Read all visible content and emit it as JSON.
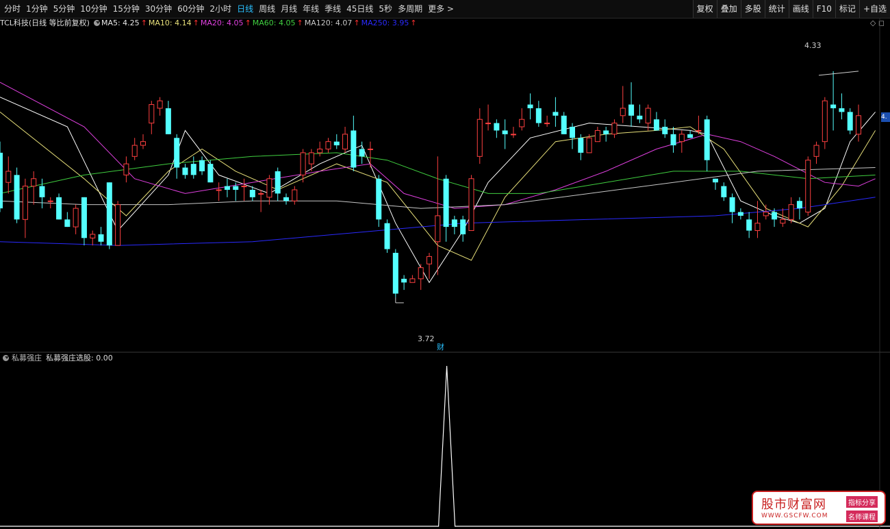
{
  "toolbar": {
    "periods": [
      "分时",
      "1分钟",
      "5分钟",
      "10分钟",
      "15分钟",
      "30分钟",
      "60分钟",
      "2小时",
      "日线",
      "周线",
      "月线",
      "年线",
      "季线",
      "45日线",
      "5秒",
      "多周期",
      "更多 >"
    ],
    "active_index": 8,
    "buttons": [
      "复权",
      "叠加",
      "多股",
      "统计",
      "画线",
      "F10",
      "标记",
      "+自选"
    ]
  },
  "legend": {
    "title": "TCL科技(日线 等比前复权)",
    "items": [
      {
        "label": "MA5: 4.25",
        "color": "#ffffff"
      },
      {
        "label": "MA10: 4.14",
        "color": "#e8e07a"
      },
      {
        "label": "MA20: 4.05",
        "color": "#e040e0"
      },
      {
        "label": "MA60: 4.05",
        "color": "#40d040"
      },
      {
        "label": "MA120: 4.07",
        "color": "#c8c8c8"
      },
      {
        "label": "MA250: 3.95",
        "color": "#2a2aff"
      }
    ],
    "arrow": "↑"
  },
  "right_icons": "◇ ◻",
  "price_tag": "4.",
  "annotations": {
    "high": "4.33",
    "low": "3.72",
    "fin_badge": "财"
  },
  "indicator": {
    "name": "私募强庄",
    "value_label": "私募强庄选股: 0.00"
  },
  "watermark": {
    "title": "股市财富网",
    "url": "WWW.GSCFW.COM",
    "tag1": "指标分享",
    "tag2": "名师课程"
  },
  "colors": {
    "up": "#ff4040",
    "down": "#54ffff",
    "background": "#000000",
    "active_tab": "#29c0ff"
  },
  "chart_data": {
    "type": "candlestick",
    "ylim": [
      3.62,
      4.4
    ],
    "high_label": 4.33,
    "low_label": 3.72,
    "candles": [
      {
        "o": 4.11,
        "c": 3.96,
        "h": 4.14,
        "l": 3.95
      },
      {
        "o": 4.03,
        "c": 4.06,
        "h": 4.1,
        "l": 4.0
      },
      {
        "o": 4.05,
        "c": 3.93,
        "h": 4.07,
        "l": 3.92
      },
      {
        "o": 3.93,
        "c": 4.02,
        "h": 4.04,
        "l": 3.88
      },
      {
        "o": 4.02,
        "c": 4.04,
        "h": 4.06,
        "l": 3.97
      },
      {
        "o": 4.02,
        "c": 3.99,
        "h": 4.04,
        "l": 3.96
      },
      {
        "o": 3.98,
        "c": 3.98,
        "h": 3.99,
        "l": 3.96
      },
      {
        "o": 3.99,
        "c": 3.93,
        "h": 4.0,
        "l": 3.93
      },
      {
        "o": 3.93,
        "c": 3.91,
        "h": 3.95,
        "l": 3.91
      },
      {
        "o": 3.91,
        "c": 3.96,
        "h": 3.97,
        "l": 3.89
      },
      {
        "o": 3.99,
        "c": 3.88,
        "h": 3.99,
        "l": 3.86
      },
      {
        "o": 3.88,
        "c": 3.89,
        "h": 3.9,
        "l": 3.86
      },
      {
        "o": 3.89,
        "c": 3.87,
        "h": 3.91,
        "l": 3.86
      },
      {
        "o": 4.03,
        "c": 3.86,
        "h": 4.03,
        "l": 3.85
      },
      {
        "o": 3.86,
        "c": 3.97,
        "h": 3.98,
        "l": 3.86
      },
      {
        "o": 4.05,
        "c": 4.08,
        "h": 4.1,
        "l": 4.03
      },
      {
        "o": 4.1,
        "c": 4.13,
        "h": 4.15,
        "l": 4.09
      },
      {
        "o": 4.13,
        "c": 4.14,
        "h": 4.16,
        "l": 4.12
      },
      {
        "o": 4.19,
        "c": 4.24,
        "h": 4.25,
        "l": 4.16
      },
      {
        "o": 4.23,
        "c": 4.25,
        "h": 4.26,
        "l": 4.21
      },
      {
        "o": 4.23,
        "c": 4.16,
        "h": 4.25,
        "l": 4.16
      },
      {
        "o": 4.15,
        "c": 4.07,
        "h": 4.16,
        "l": 4.04
      },
      {
        "o": 4.07,
        "c": 4.05,
        "h": 4.08,
        "l": 4.04
      },
      {
        "o": 4.08,
        "c": 4.05,
        "h": 4.1,
        "l": 4.04
      },
      {
        "o": 4.09,
        "c": 4.06,
        "h": 4.1,
        "l": 4.05
      },
      {
        "o": 4.08,
        "c": 4.03,
        "h": 4.09,
        "l": 4.03
      },
      {
        "o": 4.01,
        "c": 4.01,
        "h": 4.03,
        "l": 3.98
      },
      {
        "o": 4.02,
        "c": 4.01,
        "h": 4.04,
        "l": 3.99
      },
      {
        "o": 4.02,
        "c": 4.01,
        "h": 4.03,
        "l": 3.98
      },
      {
        "o": 4.02,
        "c": 4.02,
        "h": 4.04,
        "l": 3.98
      },
      {
        "o": 4.01,
        "c": 3.99,
        "h": 4.02,
        "l": 3.98
      },
      {
        "o": 4.0,
        "c": 4.0,
        "h": 4.01,
        "l": 3.95
      },
      {
        "o": 3.99,
        "c": 4.04,
        "h": 4.05,
        "l": 3.97
      },
      {
        "o": 4.06,
        "c": 4.0,
        "h": 4.07,
        "l": 3.98
      },
      {
        "o": 3.99,
        "c": 3.98,
        "h": 4.0,
        "l": 3.97
      },
      {
        "o": 3.98,
        "c": 4.01,
        "h": 4.02,
        "l": 3.97
      },
      {
        "o": 4.05,
        "c": 4.11,
        "h": 4.12,
        "l": 4.03
      },
      {
        "o": 4.08,
        "c": 4.11,
        "h": 4.12,
        "l": 4.06
      },
      {
        "o": 4.11,
        "c": 4.12,
        "h": 4.14,
        "l": 4.1
      },
      {
        "o": 4.12,
        "c": 4.14,
        "h": 4.15,
        "l": 4.11
      },
      {
        "o": 4.14,
        "c": 4.13,
        "h": 4.16,
        "l": 4.12
      },
      {
        "o": 4.12,
        "c": 4.16,
        "h": 4.18,
        "l": 4.11
      },
      {
        "o": 4.17,
        "c": 4.07,
        "h": 4.21,
        "l": 4.06
      },
      {
        "o": 4.12,
        "c": 4.1,
        "h": 4.14,
        "l": 4.08
      },
      {
        "o": 4.12,
        "c": 4.12,
        "h": 4.14,
        "l": 4.07
      },
      {
        "o": 4.04,
        "c": 3.93,
        "h": 4.05,
        "l": 3.91
      },
      {
        "o": 3.92,
        "c": 3.85,
        "h": 3.93,
        "l": 3.84
      },
      {
        "o": 3.84,
        "c": 3.73,
        "h": 3.85,
        "l": 3.72
      },
      {
        "o": 3.77,
        "c": 3.76,
        "h": 3.78,
        "l": 3.74
      },
      {
        "o": 3.76,
        "c": 3.77,
        "h": 3.78,
        "l": 3.76
      },
      {
        "o": 3.77,
        "c": 3.8,
        "h": 3.81,
        "l": 3.74
      },
      {
        "o": 3.81,
        "c": 3.83,
        "h": 3.84,
        "l": 3.77
      },
      {
        "o": 3.87,
        "c": 3.94,
        "h": 4.1,
        "l": 3.78
      },
      {
        "o": 4.04,
        "c": 3.91,
        "h": 4.05,
        "l": 3.87
      },
      {
        "o": 3.93,
        "c": 3.91,
        "h": 3.94,
        "l": 3.89
      },
      {
        "o": 3.93,
        "c": 3.89,
        "h": 3.94,
        "l": 3.87
      },
      {
        "o": 3.9,
        "c": 4.04,
        "h": 4.05,
        "l": 3.9
      },
      {
        "o": 4.1,
        "c": 4.2,
        "h": 4.23,
        "l": 4.08
      },
      {
        "o": 4.19,
        "c": 4.19,
        "h": 4.24,
        "l": 4.17
      },
      {
        "o": 4.19,
        "c": 4.17,
        "h": 4.2,
        "l": 4.15
      },
      {
        "o": 4.17,
        "c": 4.16,
        "h": 4.2,
        "l": 4.12
      },
      {
        "o": 4.16,
        "c": 4.16,
        "h": 4.18,
        "l": 4.15
      },
      {
        "o": 4.18,
        "c": 4.2,
        "h": 4.23,
        "l": 4.17
      },
      {
        "o": 4.24,
        "c": 4.23,
        "h": 4.27,
        "l": 4.2
      },
      {
        "o": 4.23,
        "c": 4.19,
        "h": 4.25,
        "l": 4.18
      },
      {
        "o": 4.19,
        "c": 4.19,
        "h": 4.21,
        "l": 4.18
      },
      {
        "o": 4.22,
        "c": 4.21,
        "h": 4.26,
        "l": 4.18
      },
      {
        "o": 4.21,
        "c": 4.16,
        "h": 4.22,
        "l": 4.16
      },
      {
        "o": 4.18,
        "c": 4.15,
        "h": 4.19,
        "l": 4.12
      },
      {
        "o": 4.15,
        "c": 4.11,
        "h": 4.16,
        "l": 4.09
      },
      {
        "o": 4.11,
        "c": 4.15,
        "h": 4.16,
        "l": 4.11
      },
      {
        "o": 4.14,
        "c": 4.17,
        "h": 4.18,
        "l": 4.14
      },
      {
        "o": 4.17,
        "c": 4.16,
        "h": 4.18,
        "l": 4.14
      },
      {
        "o": 4.16,
        "c": 4.19,
        "h": 4.2,
        "l": 4.15
      },
      {
        "o": 4.21,
        "c": 4.23,
        "h": 4.29,
        "l": 4.19
      },
      {
        "o": 4.24,
        "c": 4.21,
        "h": 4.3,
        "l": 4.18
      },
      {
        "o": 4.21,
        "c": 4.2,
        "h": 4.24,
        "l": 4.19
      },
      {
        "o": 4.19,
        "c": 4.23,
        "h": 4.24,
        "l": 4.17
      },
      {
        "o": 4.2,
        "c": 4.17,
        "h": 4.22,
        "l": 4.17
      },
      {
        "o": 4.18,
        "c": 4.16,
        "h": 4.2,
        "l": 4.15
      },
      {
        "o": 4.16,
        "c": 4.13,
        "h": 4.18,
        "l": 4.11
      },
      {
        "o": 4.14,
        "c": 4.16,
        "h": 4.17,
        "l": 4.11
      },
      {
        "o": 4.16,
        "c": 4.15,
        "h": 4.17,
        "l": 4.15
      },
      {
        "o": 4.17,
        "c": 4.17,
        "h": 4.21,
        "l": 4.16
      },
      {
        "o": 4.2,
        "c": 4.09,
        "h": 4.21,
        "l": 4.06
      },
      {
        "o": 4.04,
        "c": 4.03,
        "h": 4.04,
        "l": 4.01
      },
      {
        "o": 4.02,
        "c": 3.99,
        "h": 4.03,
        "l": 3.98
      },
      {
        "o": 3.99,
        "c": 3.95,
        "h": 4.0,
        "l": 3.92
      },
      {
        "o": 3.95,
        "c": 3.94,
        "h": 3.96,
        "l": 3.93
      },
      {
        "o": 3.93,
        "c": 3.9,
        "h": 3.95,
        "l": 3.88
      },
      {
        "o": 3.9,
        "c": 3.92,
        "h": 3.98,
        "l": 3.88
      },
      {
        "o": 3.94,
        "c": 3.95,
        "h": 3.97,
        "l": 3.93
      },
      {
        "o": 3.95,
        "c": 3.93,
        "h": 3.96,
        "l": 3.91
      },
      {
        "o": 3.92,
        "c": 3.93,
        "h": 3.96,
        "l": 3.91
      },
      {
        "o": 3.93,
        "c": 3.97,
        "h": 3.99,
        "l": 3.92
      },
      {
        "o": 3.98,
        "c": 3.96,
        "h": 3.99,
        "l": 3.93
      },
      {
        "o": 3.95,
        "c": 4.09,
        "h": 4.1,
        "l": 3.94
      },
      {
        "o": 4.1,
        "c": 4.13,
        "h": 4.14,
        "l": 4.08
      },
      {
        "o": 4.14,
        "c": 4.25,
        "h": 4.26,
        "l": 4.12
      },
      {
        "o": 4.24,
        "c": 4.23,
        "h": 4.33,
        "l": 4.17
      },
      {
        "o": 4.23,
        "c": 4.22,
        "h": 4.27,
        "l": 4.2
      },
      {
        "o": 4.22,
        "c": 4.17,
        "h": 4.23,
        "l": 4.16
      },
      {
        "o": 4.16,
        "c": 4.21,
        "h": 4.24,
        "l": 4.14
      }
    ],
    "ma": [
      {
        "name": "MA5",
        "color": "#ffffff",
        "points": [
          [
            0,
            4.26
          ],
          [
            8,
            4.18
          ],
          [
            14,
            3.9
          ],
          [
            20,
            4.05
          ],
          [
            22,
            4.17
          ],
          [
            26,
            4.05
          ],
          [
            32,
            4.0
          ],
          [
            38,
            4.08
          ],
          [
            43,
            4.13
          ],
          [
            47,
            3.92
          ],
          [
            51,
            3.76
          ],
          [
            55,
            3.9
          ],
          [
            58,
            4.03
          ],
          [
            63,
            4.15
          ],
          [
            70,
            4.19
          ],
          [
            76,
            4.18
          ],
          [
            82,
            4.17
          ],
          [
            84,
            4.16
          ],
          [
            88,
            3.98
          ],
          [
            92,
            3.94
          ],
          [
            95,
            3.92
          ],
          [
            98,
            3.96
          ],
          [
            101,
            4.14
          ],
          [
            104,
            4.22
          ]
        ]
      },
      {
        "name": "MA10",
        "color": "#e8e07a",
        "points": [
          [
            0,
            4.22
          ],
          [
            10,
            4.04
          ],
          [
            15,
            3.94
          ],
          [
            20,
            4.06
          ],
          [
            24,
            4.12
          ],
          [
            28,
            4.06
          ],
          [
            33,
            4.01
          ],
          [
            40,
            4.08
          ],
          [
            46,
            4.03
          ],
          [
            52,
            3.86
          ],
          [
            56,
            3.82
          ],
          [
            60,
            3.99
          ],
          [
            66,
            4.14
          ],
          [
            72,
            4.16
          ],
          [
            78,
            4.17
          ],
          [
            82,
            4.18
          ],
          [
            86,
            4.12
          ],
          [
            91,
            3.96
          ],
          [
            96,
            3.91
          ],
          [
            100,
            4.02
          ],
          [
            104,
            4.17
          ]
        ]
      },
      {
        "name": "MA20",
        "color": "#e040e0",
        "points": [
          [
            0,
            4.3
          ],
          [
            10,
            4.18
          ],
          [
            16,
            4.04
          ],
          [
            22,
            4.0
          ],
          [
            30,
            4.03
          ],
          [
            38,
            4.06
          ],
          [
            44,
            4.08
          ],
          [
            48,
            4.0
          ],
          [
            54,
            3.96
          ],
          [
            60,
            3.97
          ],
          [
            66,
            4.01
          ],
          [
            72,
            4.06
          ],
          [
            78,
            4.12
          ],
          [
            84,
            4.16
          ],
          [
            88,
            4.14
          ],
          [
            92,
            4.1
          ],
          [
            98,
            4.03
          ],
          [
            102,
            4.02
          ],
          [
            104,
            4.04
          ]
        ]
      },
      {
        "name": "MA60",
        "color": "#40d040",
        "points": [
          [
            0,
            4.0
          ],
          [
            10,
            4.05
          ],
          [
            20,
            4.08
          ],
          [
            30,
            4.1
          ],
          [
            40,
            4.11
          ],
          [
            46,
            4.09
          ],
          [
            52,
            4.04
          ],
          [
            58,
            4.0
          ],
          [
            64,
            4.0
          ],
          [
            72,
            4.03
          ],
          [
            80,
            4.06
          ],
          [
            88,
            4.06
          ],
          [
            96,
            4.04
          ],
          [
            104,
            4.05
          ]
        ]
      },
      {
        "name": "MA120",
        "color": "#c8c8c8",
        "points": [
          [
            0,
            3.98
          ],
          [
            10,
            3.97
          ],
          [
            20,
            3.97
          ],
          [
            30,
            3.98
          ],
          [
            40,
            3.98
          ],
          [
            50,
            3.96
          ],
          [
            60,
            3.97
          ],
          [
            70,
            4.0
          ],
          [
            80,
            4.03
          ],
          [
            90,
            4.06
          ],
          [
            104,
            4.07
          ]
        ]
      },
      {
        "name": "MA250",
        "color": "#2a2aff",
        "points": [
          [
            0,
            3.87
          ],
          [
            14,
            3.86
          ],
          [
            30,
            3.87
          ],
          [
            45,
            3.9
          ],
          [
            55,
            3.92
          ],
          [
            70,
            3.93
          ],
          [
            85,
            3.94
          ],
          [
            95,
            3.96
          ],
          [
            104,
            3.99
          ]
        ]
      }
    ],
    "indicator_values": {
      "zero_before": 53,
      "spike_index": 53,
      "spike_value": 1
    }
  }
}
